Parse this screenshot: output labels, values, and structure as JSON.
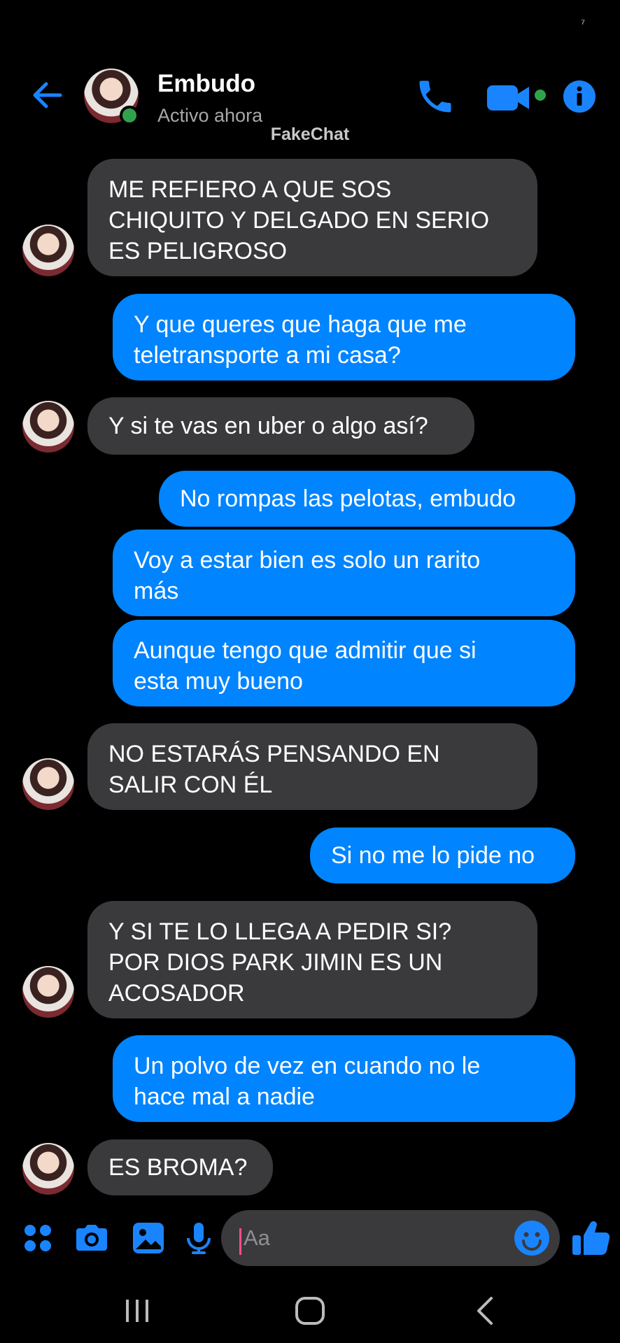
{
  "status_bar": {
    "glyph": "⁷"
  },
  "header": {
    "contact_name": "Embudo",
    "contact_status": "Activo ahora",
    "back_icon": "arrow-left-icon",
    "phone_icon": "phone-icon",
    "video_icon": "video-camera-icon",
    "info_icon": "info-icon",
    "online": true
  },
  "watermark": "FakeChat",
  "messages": [
    {
      "from": "contact",
      "lines": [
        "ME REFIERO A QUE SOS",
        "CHIQUITO Y DELGADO EN SERIO",
        "ES PELIGROSO"
      ]
    },
    {
      "from": "me",
      "lines": [
        "Y que queres que haga que me",
        "teletransporte a mi casa?"
      ]
    },
    {
      "from": "contact",
      "lines": [
        "Y si te vas en uber o algo así?"
      ]
    },
    {
      "from": "me",
      "lines": [
        "No rompas las pelotas, embudo"
      ]
    },
    {
      "from": "me",
      "lines": [
        "Voy a estar bien es solo un rarito",
        "más"
      ]
    },
    {
      "from": "me",
      "lines": [
        "Aunque tengo que admitir que si",
        "esta muy bueno"
      ]
    },
    {
      "from": "contact",
      "lines": [
        "NO ESTARÁS PENSANDO EN",
        "SALIR CON ÉL"
      ]
    },
    {
      "from": "me",
      "lines": [
        "Si no me lo pide no"
      ]
    },
    {
      "from": "contact",
      "lines": [
        "Y SI TE LO LLEGA A PEDIR SI?",
        "POR DIOS PARK JIMIN ES UN",
        "ACOSADOR"
      ]
    },
    {
      "from": "me",
      "lines": [
        "Un polvo de vez en cuando no le",
        "hace mal a nadie"
      ]
    },
    {
      "from": "contact",
      "lines": [
        "ES BROMA?"
      ]
    }
  ],
  "composer": {
    "placeholder": "Aa",
    "tools": [
      "apps-icon",
      "camera-icon",
      "gallery-icon",
      "microphone-icon"
    ],
    "emoji_icon": "emoji-icon",
    "like_icon": "thumbs-up-icon"
  },
  "navbar": {
    "icons": [
      "recent-apps-icon",
      "home-icon",
      "back-icon"
    ]
  },
  "colors": {
    "accent": "#0084ff",
    "sent_bubble": "#0084ff",
    "received_bubble": "#3a3a3c",
    "online": "#31a24c",
    "caret": "#ff4f8b"
  }
}
